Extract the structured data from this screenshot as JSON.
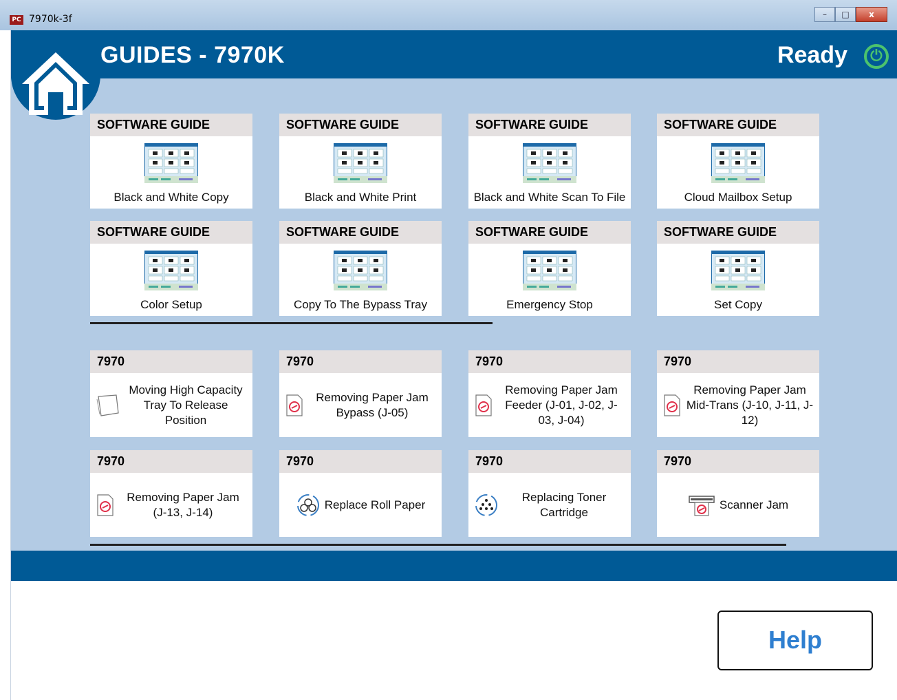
{
  "window": {
    "title": "7970k-3f",
    "app_icon": "PC"
  },
  "window_controls": {
    "minimize": "–",
    "maximize": "□",
    "close": "x"
  },
  "header": {
    "title": "GUIDES - 7970K",
    "status": "Ready",
    "status_icon": "power-ready-icon"
  },
  "software_guides": [
    {
      "header": "SOFTWARE GUIDE",
      "label": "Black and White Copy"
    },
    {
      "header": "SOFTWARE GUIDE",
      "label": "Black and White Print"
    },
    {
      "header": "SOFTWARE GUIDE",
      "label": "Black and White Scan To File"
    },
    {
      "header": "SOFTWARE GUIDE",
      "label": "Cloud Mailbox Setup"
    },
    {
      "header": "SOFTWARE GUIDE",
      "label": "Color Setup"
    },
    {
      "header": "SOFTWARE GUIDE",
      "label": "Copy To The Bypass Tray"
    },
    {
      "header": "SOFTWARE GUIDE",
      "label": "Emergency Stop"
    },
    {
      "header": "SOFTWARE GUIDE",
      "label": "Set Copy"
    }
  ],
  "guides_7970": [
    {
      "header": "7970",
      "label": "Moving High Capacity Tray To Release Position",
      "icon": "paper-sheet-icon"
    },
    {
      "header": "7970",
      "label": "Removing Paper Jam Bypass (J-05)",
      "icon": "paper-jam-icon"
    },
    {
      "header": "7970",
      "label": "Removing Paper Jam Feeder (J-01, J-02, J-03, J-04)",
      "icon": "paper-jam-icon"
    },
    {
      "header": "7970",
      "label": "Removing Paper Jam Mid-Trans (J-10, J-11, J-12)",
      "icon": "paper-jam-icon"
    },
    {
      "header": "7970",
      "label": "Removing Paper Jam (J-13, J-14)",
      "icon": "paper-jam-icon"
    },
    {
      "header": "7970",
      "label": "Replace Roll Paper",
      "icon": "roll-paper-icon"
    },
    {
      "header": "7970",
      "label": "Replacing Toner Cartridge",
      "icon": "toner-cartridge-icon"
    },
    {
      "header": "7970",
      "label": "Scanner Jam",
      "icon": "scanner-jam-icon"
    }
  ],
  "footer": {
    "help_label": "Help"
  }
}
